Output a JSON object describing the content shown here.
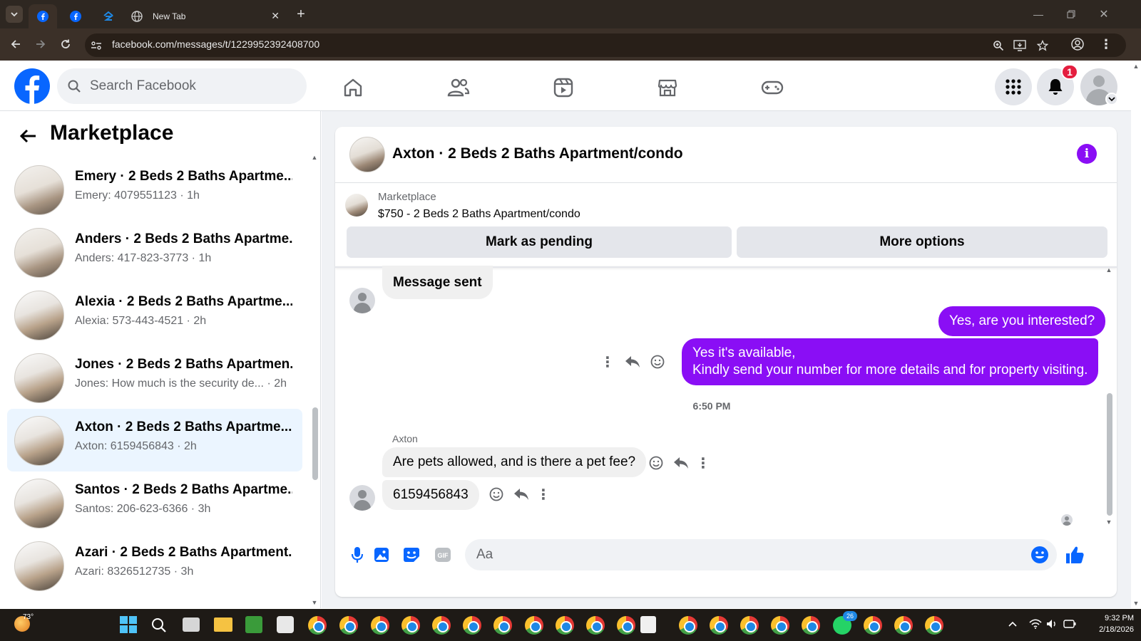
{
  "browser": {
    "tabs": [
      {
        "icon": "facebook-icon",
        "label": ""
      },
      {
        "icon": "facebook-icon",
        "label": ""
      },
      {
        "icon": "zillow-icon",
        "label": ""
      },
      {
        "icon": "globe-icon",
        "label": "New Tab"
      }
    ],
    "url": "facebook.com/messages/t/1229952392408700"
  },
  "header": {
    "search_placeholder": "Search Facebook",
    "notification_count": "1"
  },
  "sidebar": {
    "title": "Marketplace",
    "conversations": [
      {
        "title": "Emery · 2 Beds 2 Baths Apartme...",
        "preview": "Emery: 4079551123 · 1h",
        "active": false
      },
      {
        "title": "Anders · 2 Beds 2 Baths Apartme...",
        "preview": "Anders: 417-823-3773 · 1h",
        "active": false
      },
      {
        "title": "Alexia · 2 Beds 2 Baths Apartme...",
        "preview": "Alexia: 573-443-4521 · 2h",
        "active": false
      },
      {
        "title": "Jones · 2 Beds 2 Baths Apartmen...",
        "preview": "Jones: How much is the security de...  · 2h",
        "active": false
      },
      {
        "title": "Axton · 2 Beds 2 Baths Apartme...",
        "preview": "Axton: 6159456843 · 2h",
        "active": true
      },
      {
        "title": "Santos · 2 Beds 2 Baths Apartme...",
        "preview": "Santos: 206-623-6366 · 3h",
        "active": false
      },
      {
        "title": "Azari · 2 Beds 2 Baths Apartment...",
        "preview": "Azari: 8326512735 · 3h",
        "active": false
      }
    ]
  },
  "chat": {
    "title": "Axton · 2 Beds 2 Baths Apartment/condo",
    "listing_source": "Marketplace",
    "listing_detail": "$750 - 2 Beds 2 Baths Apartment/condo",
    "mark_pending_label": "Mark as pending",
    "more_options_label": "More options",
    "messages": {
      "sent_notice": "Message sent",
      "out1": "Yes, are you interested?",
      "out2_line1": "Yes it's available,",
      "out2_line2": "Kindly send your number for more details and for property visiting.",
      "timestamp": "6:50 PM",
      "sender_name": "Axton",
      "in1": "Are pets allowed, and is there a pet fee?",
      "in2": "6159456843"
    },
    "composer_placeholder": "Aa"
  },
  "taskbar": {
    "weather": "73°",
    "whatsapp_badge": "26",
    "time": "9:32 PM",
    "date": "2/18/2026"
  },
  "colors": {
    "facebook_blue": "#0866ff",
    "messenger_purple": "#8a0ef5",
    "active_row": "#ebf5ff",
    "badge_red": "#e41e3f"
  }
}
